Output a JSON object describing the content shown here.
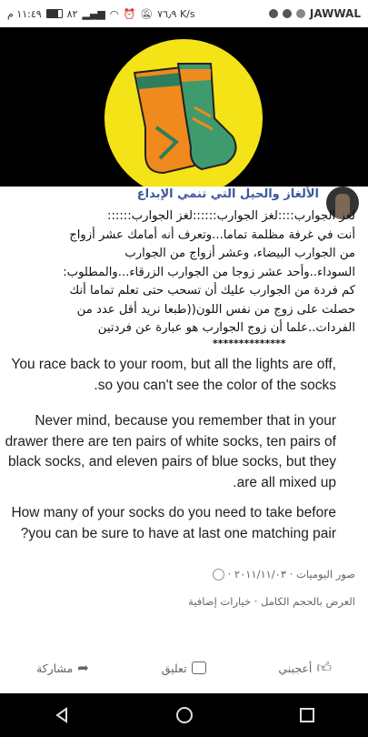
{
  "status_bar": {
    "time": "١١:٤٩ م",
    "battery": "٨٢",
    "network_speed": "٧٦٫٩ K/s",
    "carrier": "JAWWAL"
  },
  "post": {
    "title": "الألغاز والحيل التي تنمي الإبداع",
    "arabic_lines": [
      "لغز الجوارب::::لغز الجوارب::::::لغز الجوارب::::::",
      "أنت في غرفة مظلمة تماما...وتعرف أنه أمامك عشر أزواج",
      "من الجوارب البيضاء، وعشر أزواج من الجوارب",
      "السوداء..وأحد عشر زوجا من الجوارب الزرقاء...والمطلوب:",
      "كم فردة من الجوارب عليك أن تسحب حتى تعلم تماما أنك",
      "حصلت على زوج من نفس اللون((طبعا نريد أقل عدد من",
      "الفردات..علما أن زوج الجوارب هو عبارة عن فردتين"
    ],
    "stars": "**************",
    "paragraph_1": "You race back to your room, but all the lights are off, so you can't see the color of the socks.",
    "paragraph_2": "Never mind, because you remember that in your drawer there are ten pairs of white socks, ten pairs of black socks, and eleven pairs of blue socks, but they are all mixed up.",
    "paragraph_3": "How many of your socks do you need to take before you can be sure to have at last one matching pair?",
    "album_meta": "صور اليوميات · ٢٠١١/١١/٠٣ ·",
    "view_options": "العرض بالحجم الكامل · خيارات إضافية"
  },
  "actions": {
    "like": "أعجبني",
    "comment": "تعليق",
    "share": "مشاركة"
  },
  "colors": {
    "photo_bg": "#000000",
    "badge_yellow": "#f4e316",
    "sock_green": "#3f9a6e",
    "sock_orange": "#f08a1c",
    "title_blue": "#3c5a99"
  }
}
